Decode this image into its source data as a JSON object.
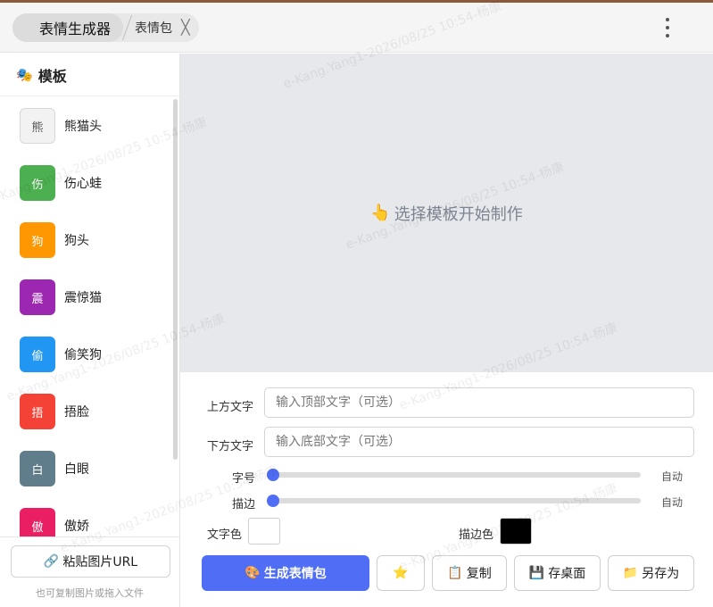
{
  "tabs": {
    "main_label": "表情生成器",
    "secondary_label": "表情包",
    "close_symbol": "╳"
  },
  "sidebar": {
    "title": "模板",
    "items": [
      {
        "glyph": "熊",
        "label": "熊猫头",
        "color": "#f2f2f2"
      },
      {
        "glyph": "伤",
        "label": "伤心蛙",
        "color": "#4caf50"
      },
      {
        "glyph": "狗",
        "label": "狗头",
        "color": "#ff9800"
      },
      {
        "glyph": "震",
        "label": "震惊猫",
        "color": "#9c27b0"
      },
      {
        "glyph": "偷",
        "label": "偷笑狗",
        "color": "#2196f3"
      },
      {
        "glyph": "捂",
        "label": "捂脸",
        "color": "#f44336"
      },
      {
        "glyph": "白",
        "label": "白眼",
        "color": "#607d8b"
      },
      {
        "glyph": "傲",
        "label": "傲娇",
        "color": "#e91e63"
      }
    ],
    "paste_button": "粘贴图片URL",
    "hint": "也可复制图片或拖入文件"
  },
  "preview": {
    "placeholder": "选择模板开始制作"
  },
  "form": {
    "top_label": "上方文字",
    "top_placeholder": "输入顶部文字（可选）",
    "bottom_label": "下方文字",
    "bottom_placeholder": "输入底部文字（可选）",
    "font_size_label": "字号",
    "font_size_value": "自动",
    "stroke_label": "描边",
    "stroke_value": "自动",
    "text_color_label": "文字色",
    "text_color": "#ffffff",
    "stroke_color_label": "描边色",
    "stroke_color": "#000000"
  },
  "actions": {
    "generate": "生成表情包",
    "copy": "复制",
    "save_desktop": "存桌面",
    "save_as": "另存为"
  },
  "watermark": "e-Kang.Yang1-2026/08/25 10:54-杨康",
  "colors": {
    "accent": "#4f6ef5",
    "preview_bg": "#e6e8ec"
  }
}
